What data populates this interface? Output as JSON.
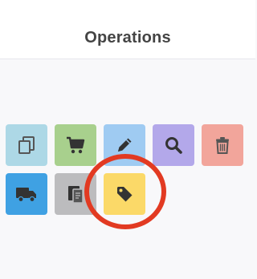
{
  "header": {
    "title": "Operations"
  },
  "operations": [
    {
      "icon": "copy-icon",
      "color": "#add8e6"
    },
    {
      "icon": "shopping-cart-icon",
      "color": "#a8d08d"
    },
    {
      "icon": "pencil-icon",
      "color": "#9fcbf2"
    },
    {
      "icon": "search-icon",
      "color": "#b3a8ea"
    },
    {
      "icon": "trash-icon",
      "color": "#f2a59b"
    },
    {
      "icon": "truck-icon",
      "color": "#3fa1e3"
    },
    {
      "icon": "document-copy-icon",
      "color": "#bcbcbe"
    },
    {
      "icon": "tag-icon",
      "color": "#fbd968"
    }
  ],
  "highlight": {
    "target": "tag-icon",
    "color": "#e23a22"
  }
}
